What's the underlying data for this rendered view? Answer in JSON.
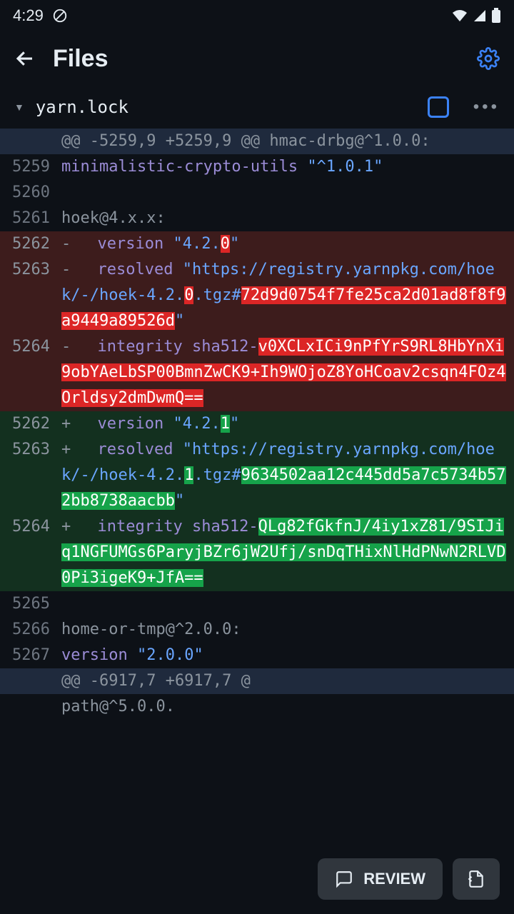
{
  "status": {
    "time": "4:29"
  },
  "header": {
    "title": "Files"
  },
  "file": {
    "name": "yarn.lock"
  },
  "diff": {
    "hunk1": "@@ -5259,9 +5259,9 @@ hmac-drbg@^1.0.0:",
    "l5259_a": "minimalistic-crypto-utils ",
    "l5259_b": "\"^1.0.1\"",
    "l5261": "hoek@4.x.x:",
    "d5262_a": "version ",
    "d5262_b": "\"4.2.",
    "d5262_c": "0",
    "d5262_d": "\"",
    "d5263_a": "resolved ",
    "d5263_b": "\"https://registry.yarnpkg.com/hoek/-/hoek-4.2.",
    "d5263_c": "0",
    "d5263_d": ".tgz#",
    "d5263_e": "72d9d0754f7fe25ca2d01ad8f8f9a9449a89526d",
    "d5263_f": "\"",
    "d5264_a": "integrity sha512-",
    "d5264_b": "v0XCLxICi9nPfYrS9RL8HbYnXi9obYAeLbSP00BmnZwCK9+Ih9WOjoZ8YoHCoav2csqn4FOz4Orldsy2dmDwmQ==",
    "a5262_a": "version ",
    "a5262_b": "\"4.2.",
    "a5262_c": "1",
    "a5262_d": "\"",
    "a5263_a": "resolved ",
    "a5263_b": "\"https://registry.yarnpkg.com/hoek/-/hoek-4.2.",
    "a5263_c": "1",
    "a5263_d": ".tgz#",
    "a5263_e": "9634502aa12c445dd5a7c5734b572bb8738aacbb",
    "a5263_f": "\"",
    "a5264_a": "integrity sha512-",
    "a5264_b": "QLg82fGkfnJ/4iy1xZ81/9SIJiq1NGFUMGs6ParyjBZr6jW2Ufj/snDqTHixNlHdPNwN2RLVD0Pi3igeK9+JfA==",
    "l5266": "home-or-tmp@^2.0.0:",
    "l5267_a": "version ",
    "l5267_b": "\"2.0.0\"",
    "hunk2": "@@ -6917,7 +6917,7 @",
    "l_last": "path@^5.0.0."
  },
  "review": {
    "label": "REVIEW"
  },
  "nums": {
    "n5259": "5259",
    "n5260": "5260",
    "n5261": "5261",
    "n5262": "5262",
    "n5263": "5263",
    "n5264": "5264",
    "n5265": "5265",
    "n5266": "5266",
    "n5267": "5267"
  }
}
